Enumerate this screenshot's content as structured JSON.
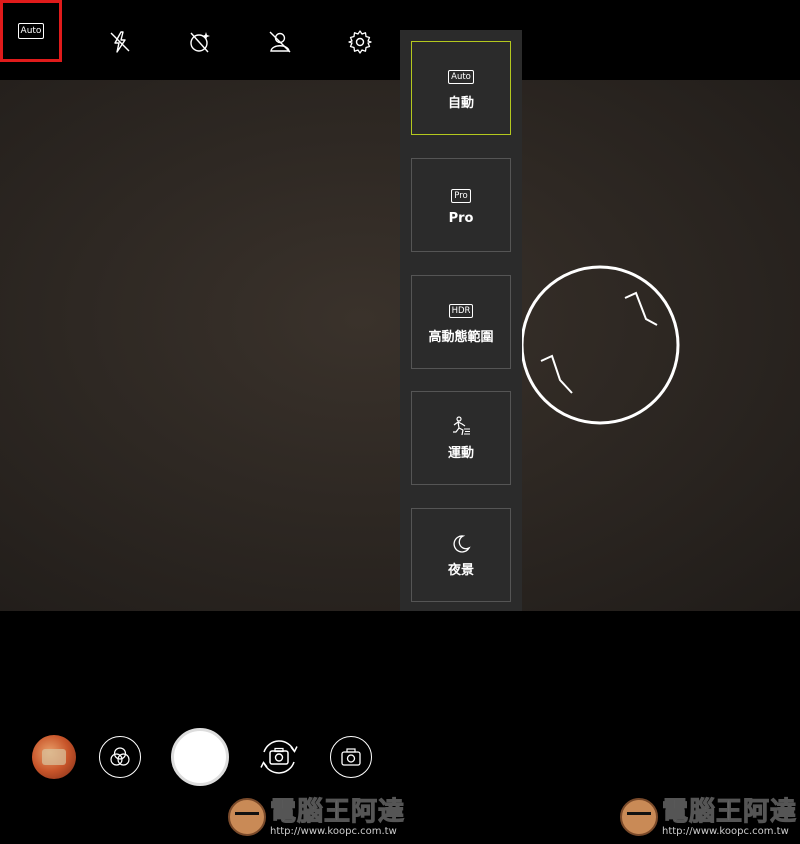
{
  "toolbar": {
    "auto_badge": "Auto",
    "icons": [
      "flash-off-icon",
      "ai-scene-icon",
      "beauty-off-icon",
      "gear-icon"
    ]
  },
  "mode_panel": {
    "items": [
      {
        "badge": "Auto",
        "label": "自動",
        "active": true
      },
      {
        "badge": "Pro",
        "label": "Pro",
        "active": false
      },
      {
        "badge": "HDR",
        "label": "高動態範圍",
        "active": false
      },
      {
        "badge": "",
        "icon": "running-person-icon",
        "label": "運動",
        "active": false
      },
      {
        "badge": "",
        "icon": "moon-icon",
        "label": "夜景",
        "active": false
      }
    ],
    "active_border_color": "#b4c81e"
  },
  "highlight_color": "#e01b1b",
  "watermark": {
    "title": "電腦王阿達",
    "url": "http://www.koopc.com.tw"
  }
}
